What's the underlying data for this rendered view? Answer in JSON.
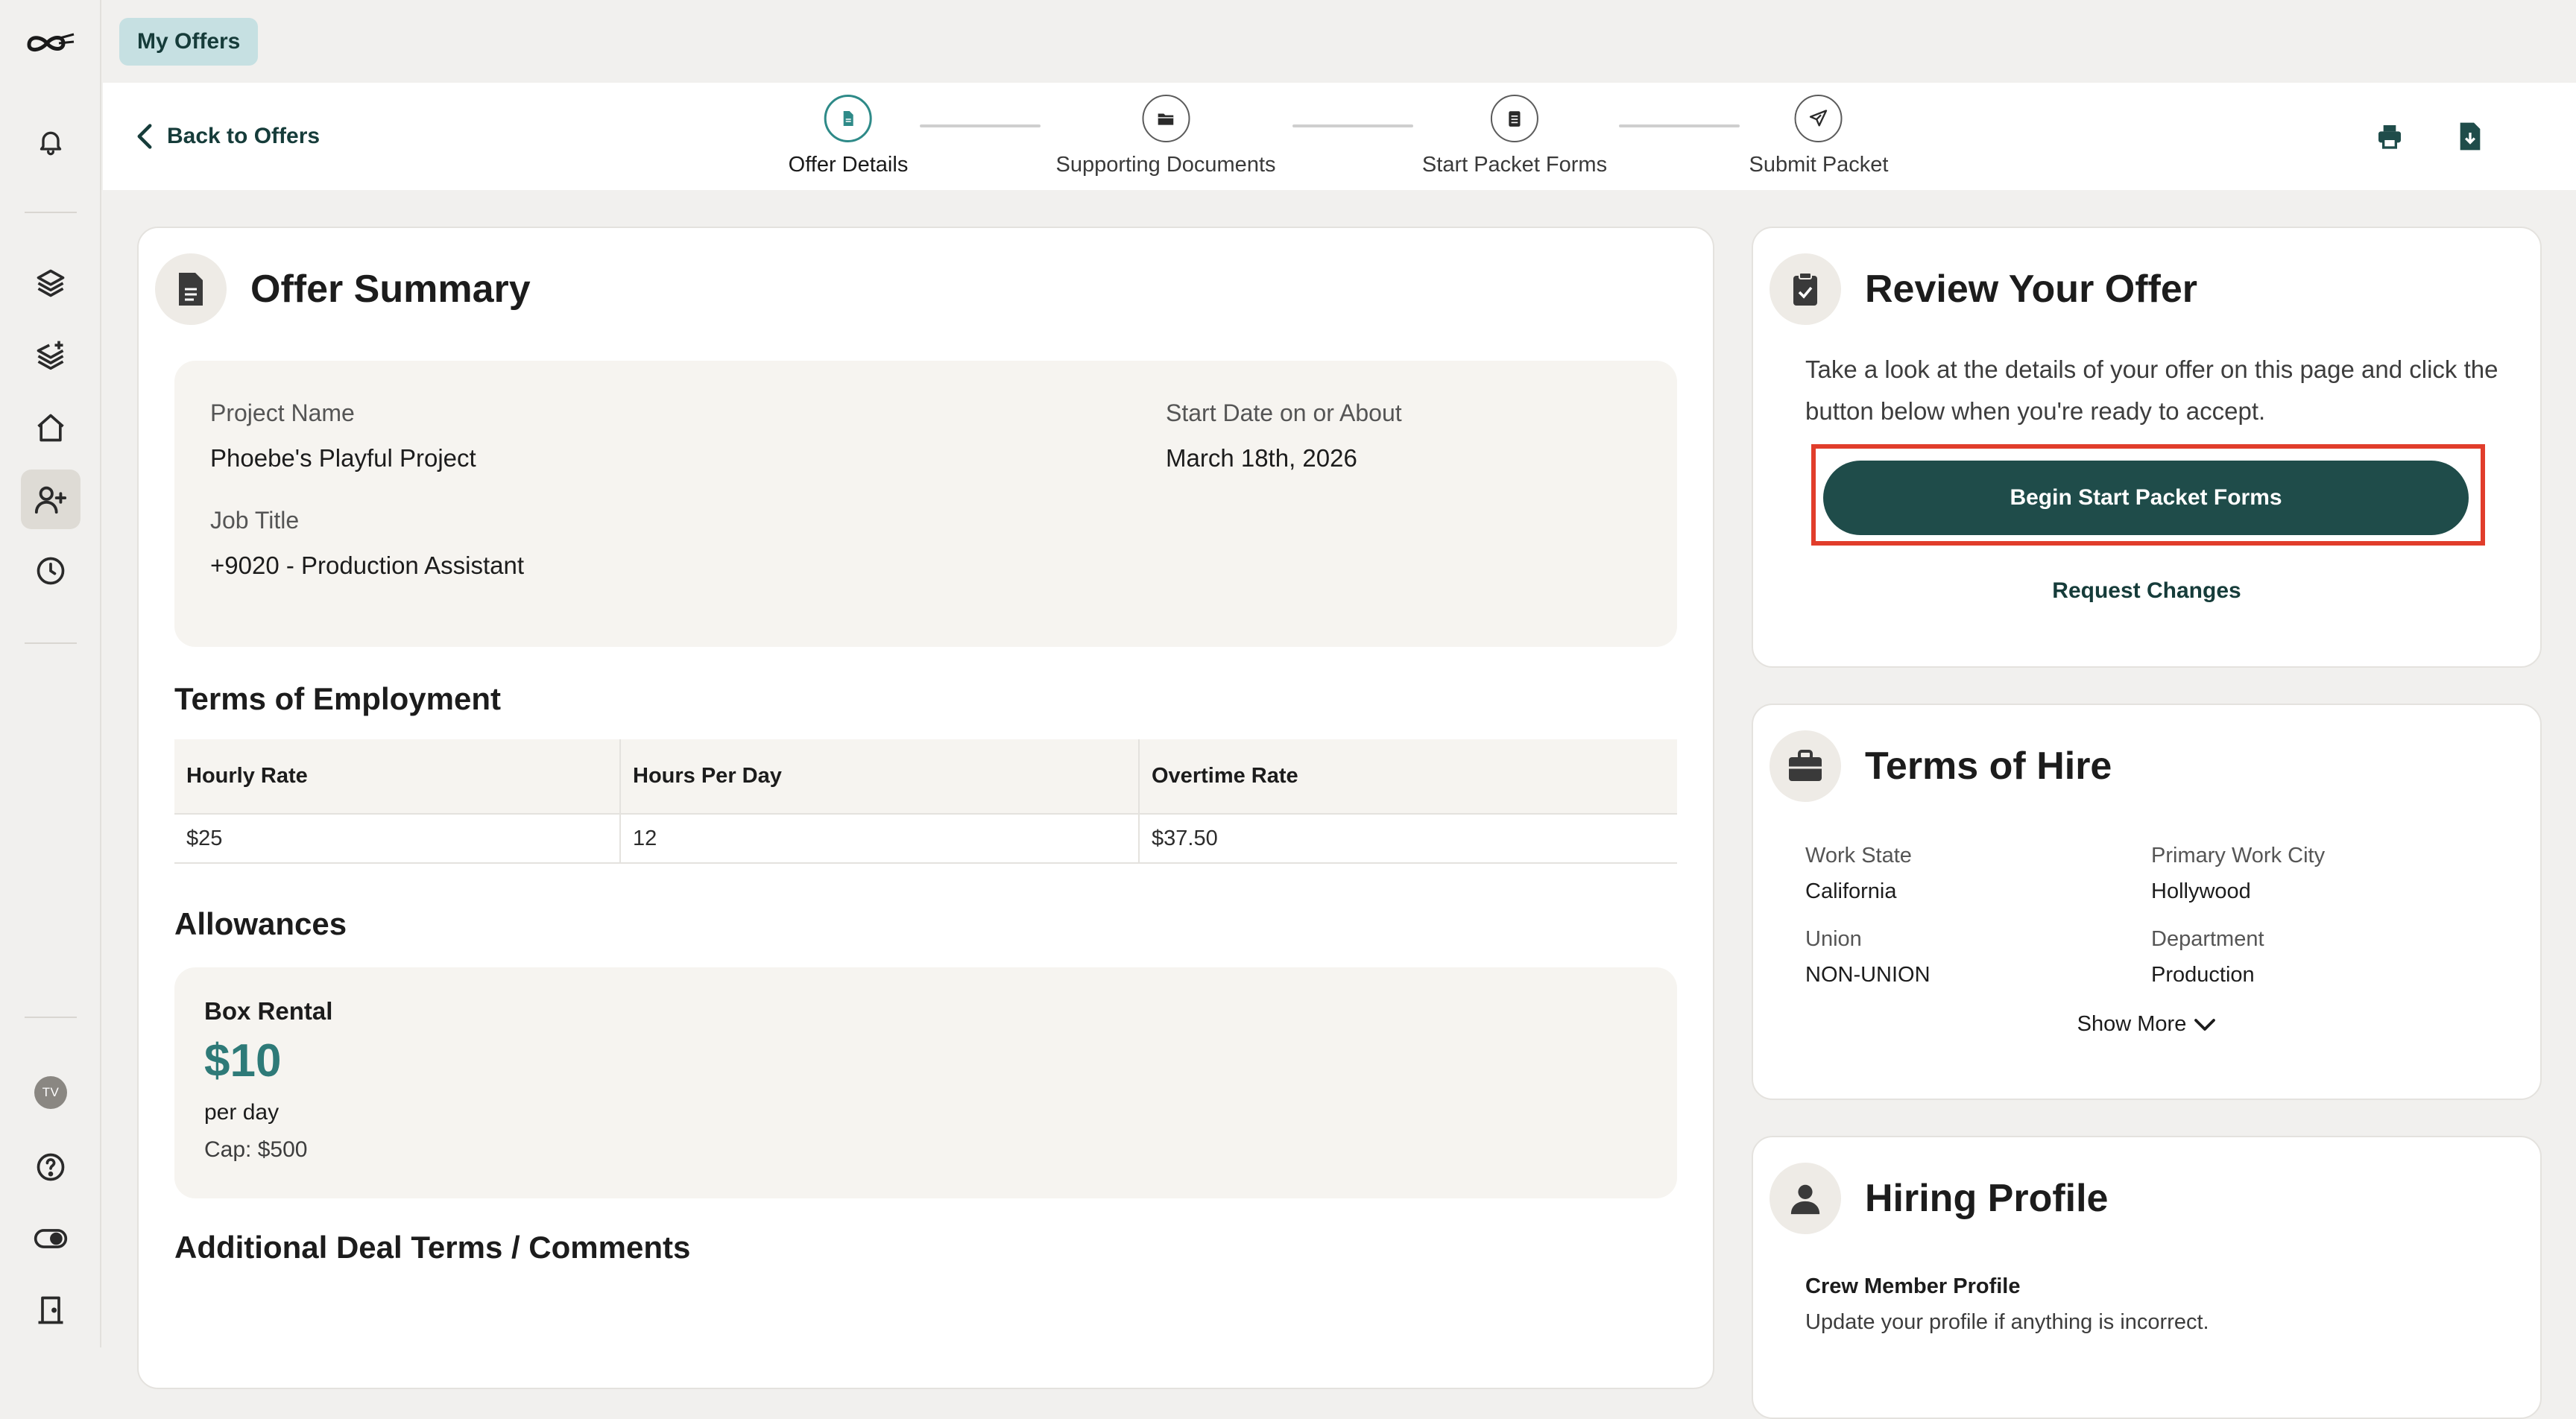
{
  "nav": {
    "chip_label": "My Offers",
    "avatar_initials": "TV"
  },
  "header": {
    "back_label": "Back to Offers",
    "steps": [
      {
        "label": "Offer Details",
        "active": true
      },
      {
        "label": "Supporting Documents",
        "active": false
      },
      {
        "label": "Start Packet Forms",
        "active": false
      },
      {
        "label": "Submit Packet",
        "active": false
      }
    ]
  },
  "offer_summary": {
    "title": "Offer Summary",
    "project_name_label": "Project Name",
    "project_name": "Phoebe's Playful Project",
    "start_date_label": "Start Date on or About",
    "start_date": "March 18th, 2026",
    "job_title_label": "Job Title",
    "job_title": "+9020 - Production Assistant",
    "terms_heading": "Terms of Employment",
    "terms_table": {
      "headers": [
        "Hourly Rate",
        "Hours Per Day",
        "Overtime Rate"
      ],
      "rows": [
        [
          "$25",
          "12",
          "$37.50"
        ]
      ]
    },
    "allowances_heading": "Allowances",
    "allowance": {
      "name": "Box Rental",
      "amount": "$10",
      "period": "per day",
      "cap": "Cap: $500"
    },
    "additional_heading": "Additional Deal Terms / Comments"
  },
  "review": {
    "title": "Review Your Offer",
    "text": "Take a look at the details of your offer on this page and click the button below when you're ready to accept.",
    "primary_button": "Begin Start Packet Forms",
    "secondary_link": "Request Changes"
  },
  "terms_of_hire": {
    "title": "Terms of Hire",
    "work_state_label": "Work State",
    "work_state": "California",
    "work_city_label": "Primary Work City",
    "work_city": "Hollywood",
    "union_label": "Union",
    "union": "NON-UNION",
    "department_label": "Department",
    "department": "Production",
    "show_more": "Show More"
  },
  "hiring_profile": {
    "title": "Hiring Profile",
    "subtitle": "Crew Member Profile",
    "text": "Update your profile if anything is incorrect."
  },
  "colors": {
    "accent": "#1f4c4a",
    "accent_teal": "#2e8a88",
    "highlight": "#e13d2b",
    "chip_bg": "#c6e0e2"
  }
}
